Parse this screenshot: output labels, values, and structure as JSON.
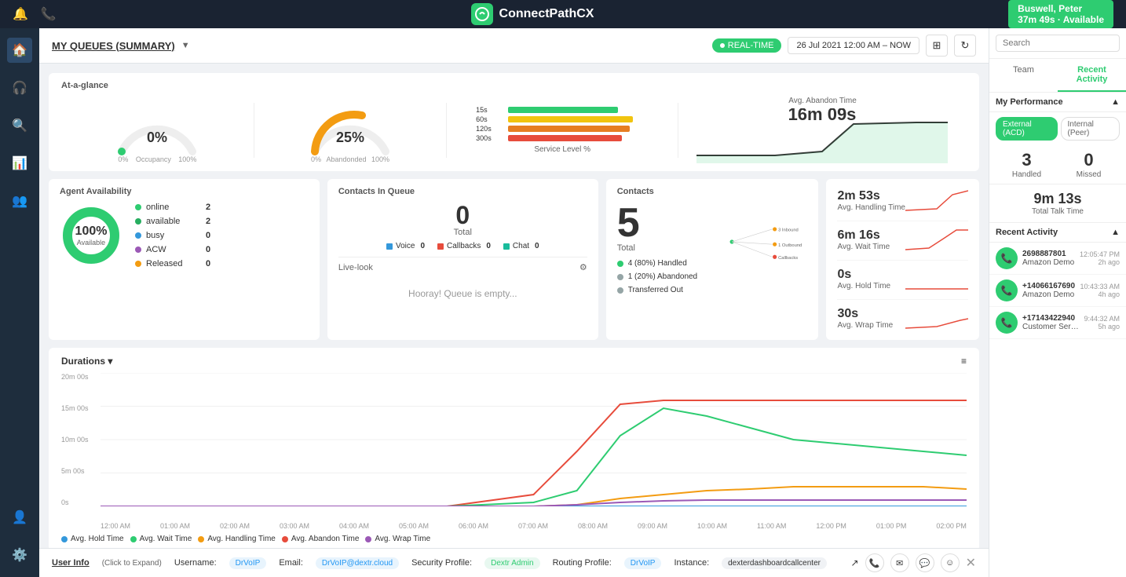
{
  "topNav": {
    "icons": [
      "bell",
      "phone"
    ],
    "brand": "ConnectPathCX",
    "user": "Buswell, Peter",
    "status": "37m 49s · Available"
  },
  "topBar": {
    "title": "MY QUEUES (SUMMARY)",
    "realtime": "REAL-TIME",
    "dateRange": "26 Jul 2021 12:00 AM – NOW"
  },
  "atAGlance": {
    "title": "At-a-glance",
    "occupancy": {
      "value": "0%",
      "min": "0%",
      "max": "100%",
      "label": "Occupancy"
    },
    "abandoned": {
      "value": "25%",
      "min": "0%",
      "max": "100%",
      "label": "Abandonded"
    },
    "serviceLevel": {
      "label": "Service Level %",
      "bars": [
        {
          "label": "15s",
          "width": 140,
          "color": "#2ecc71"
        },
        {
          "label": "60s",
          "width": 160,
          "color": "#f1c40f"
        },
        {
          "label": "120s",
          "width": 155,
          "color": "#e67e22"
        },
        {
          "label": "300s",
          "width": 145,
          "color": "#e74c3c"
        }
      ]
    },
    "avgAbandonTime": {
      "value": "16m 09s",
      "label": "Avg. Abandon Time"
    }
  },
  "agentAvailability": {
    "title": "Agent Availability",
    "donut": {
      "pct": "100%",
      "label": "Available"
    },
    "stats": [
      {
        "label": "online",
        "value": "2",
        "color": "#2ecc71"
      },
      {
        "label": "available",
        "value": "2",
        "color": "#27ae60"
      },
      {
        "label": "busy",
        "value": "0",
        "color": "#3498db"
      },
      {
        "label": "ACW",
        "value": "0",
        "color": "#9b59b6"
      },
      {
        "label": "Released",
        "value": "0",
        "color": "#f39c12"
      }
    ]
  },
  "contactsInQueue": {
    "title": "Contacts In Queue",
    "total": "0",
    "totalLabel": "Total",
    "types": [
      {
        "label": "Voice",
        "value": "0",
        "color": "#3498db"
      },
      {
        "label": "Callbacks",
        "value": "0",
        "color": "#e74c3c"
      },
      {
        "label": "Chat",
        "value": "0",
        "color": "#1abc9c"
      }
    ],
    "liveLook": "Live-look",
    "emptyMsg": "Hooray! Queue is empty..."
  },
  "contacts": {
    "title": "Contacts",
    "total": "5",
    "totalLabel": "Total",
    "breakdown": [
      {
        "label": "4 (80%) Handled",
        "color": "#2ecc71"
      },
      {
        "label": "1 (20%) Abandoned",
        "color": "#95a5a6"
      },
      {
        "label": "Transferred Out",
        "color": "#95a5a6"
      }
    ],
    "chartItems": [
      {
        "label": "3 Inbound",
        "color": "#f39c12"
      },
      {
        "label": "1 Outbound",
        "color": "#f39c12"
      },
      {
        "label": "Callbacks",
        "color": "#e74c3c"
      }
    ]
  },
  "rightStats": [
    {
      "value": "2m 53s",
      "label": "Avg. Handling Time"
    },
    {
      "value": "6m 16s",
      "label": "Avg. Wait Time"
    },
    {
      "value": "0s",
      "label": "Avg. Hold Time"
    },
    {
      "value": "30s",
      "label": "Avg. Wrap Time"
    }
  ],
  "durations": {
    "title": "Durations",
    "yLabels": [
      "20m 00s",
      "15m 00s",
      "10m 00s",
      "5m 00s",
      "0s"
    ],
    "xLabels": [
      "12:00 AM",
      "01:00 AM",
      "02:00 AM",
      "03:00 AM",
      "04:00 AM",
      "05:00 AM",
      "06:00 AM",
      "07:00 AM",
      "08:00 AM",
      "09:00 AM",
      "10:00 AM",
      "11:00 AM",
      "12:00 PM",
      "01:00 PM",
      "02:00 PM"
    ],
    "legend": [
      {
        "label": "Avg. Hold Time",
        "color": "#3498db"
      },
      {
        "label": "Avg. Wait Time",
        "color": "#2ecc71"
      },
      {
        "label": "Avg. Handling Time",
        "color": "#f39c12"
      },
      {
        "label": "Avg. Abandon Time",
        "color": "#e74c3c"
      },
      {
        "label": "Avg. Wrap Time",
        "color": "#9b59b6"
      }
    ]
  },
  "rightSidebar": {
    "searchPlaceholder": "Search",
    "tabs": [
      "Team",
      "Recent Activity"
    ],
    "activeTab": "Recent Activity",
    "myPerformance": "My Performance",
    "perfTabs": [
      "External (ACD)",
      "Internal (Peer)"
    ],
    "activePerfTab": "External (ACD)",
    "handled": {
      "value": "3",
      "label": "Handled"
    },
    "missed": {
      "value": "0",
      "label": "Missed"
    },
    "talkTime": {
      "value": "9m 13s",
      "label": "Total Talk Time"
    },
    "recentActivity": "Recent Activity",
    "activities": [
      {
        "number": "2698887801",
        "name": "Amazon Demo",
        "time": "12:05:47 PM",
        "ago": "2h ago"
      },
      {
        "number": "+14066167690",
        "name": "Amazon Demo",
        "time": "10:43:33 AM",
        "ago": "4h ago"
      },
      {
        "number": "+17143422940",
        "name": "Customer Servi...",
        "time": "9:44:32 AM",
        "ago": "5h ago"
      }
    ]
  },
  "bottomBar": {
    "userInfoLabel": "User Info",
    "clickToExpand": "(Click to Expand)",
    "username": {
      "label": "Username:",
      "value": "DrVoIP"
    },
    "email": {
      "label": "Email:",
      "value": "DrVoIP@dextr.cloud"
    },
    "security": {
      "label": "Security Profile:",
      "value": "Dextr Admin"
    },
    "routing": {
      "label": "Routing Profile:",
      "value": "DrVoIP"
    },
    "instance": {
      "label": "Instance:",
      "value": "dexterdashboardcallcenter"
    }
  }
}
